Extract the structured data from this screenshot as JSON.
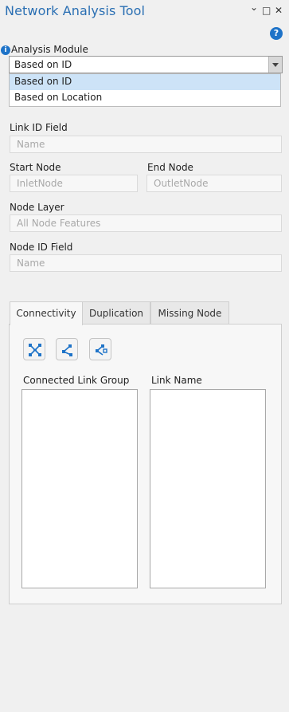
{
  "window": {
    "title": "Network Analysis Tool",
    "controls": {
      "menu": "⌄",
      "maximize": "□",
      "close": "✕"
    },
    "help": "?"
  },
  "analysis_module": {
    "info_icon": "i",
    "label": "Analysis Module",
    "selected": "Based on ID",
    "options": [
      "Based on ID",
      "Based on Location"
    ]
  },
  "link_id_field": {
    "label": "Link ID Field",
    "placeholder": "Name"
  },
  "start_node": {
    "label": "Start Node",
    "placeholder": "InletNode"
  },
  "end_node": {
    "label": "End Node",
    "placeholder": "OutletNode"
  },
  "node_layer": {
    "label": "Node Layer",
    "placeholder": "All Node Features"
  },
  "node_id_field": {
    "label": "Node ID Field",
    "placeholder": "Name"
  },
  "tabs": [
    {
      "label": "Connectivity",
      "active": true
    },
    {
      "label": "Duplication",
      "active": false
    },
    {
      "label": "Missing Node",
      "active": false
    }
  ],
  "tool_icons": [
    "network-connect-icon",
    "branch-icon",
    "node-link-icon"
  ],
  "lists": {
    "connected_link_group": "Connected Link Group",
    "link_name": "Link Name"
  },
  "colors": {
    "accent": "#2a6fb3",
    "icon": "#1e73c8",
    "selection": "#cde3f7"
  }
}
